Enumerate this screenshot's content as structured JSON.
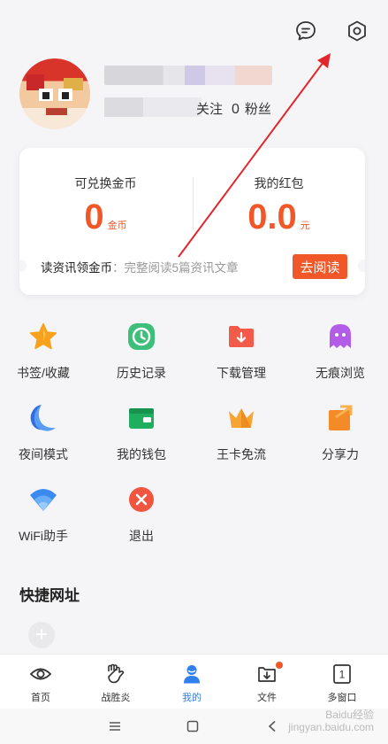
{
  "profile": {
    "following_count": "0",
    "following_label_partial": "关注",
    "fans_count": "0",
    "fans_label": "粉丝"
  },
  "wallet": {
    "coins_label": "可兑换金币",
    "coins_value": "0",
    "coins_unit": "金币",
    "redpacket_label": "我的红包",
    "redpacket_value": "0.0",
    "redpacket_unit": "元",
    "read_title": "读资讯领金币",
    "read_desc": "：完整阅读5篇资讯文章",
    "read_button": "去阅读"
  },
  "features": [
    {
      "label": "书签/收藏",
      "icon": "star-icon"
    },
    {
      "label": "历史记录",
      "icon": "clock-icon"
    },
    {
      "label": "下载管理",
      "icon": "download-folder-icon"
    },
    {
      "label": "无痕浏览",
      "icon": "ghost-icon"
    },
    {
      "label": "夜间模式",
      "icon": "moon-icon"
    },
    {
      "label": "我的钱包",
      "icon": "wallet-icon"
    },
    {
      "label": "王卡免流",
      "icon": "crown-icon"
    },
    {
      "label": "分享力",
      "icon": "share-box-icon"
    },
    {
      "label": "WiFi助手",
      "icon": "wifi-icon"
    },
    {
      "label": "退出",
      "icon": "exit-icon"
    }
  ],
  "quick_sites": {
    "title": "快捷网址",
    "add_symbol": "+"
  },
  "nav": [
    {
      "label": "首页",
      "icon": "eye-icon"
    },
    {
      "label": "战胜炎",
      "icon": "fist-icon"
    },
    {
      "label": "我的",
      "icon": "person-icon"
    },
    {
      "label": "文件",
      "icon": "file-download-icon"
    },
    {
      "label": "多窗口",
      "icon": "window-count-icon"
    }
  ],
  "window_count": "1",
  "watermark": {
    "line1": "Baidu经验",
    "line2": "jingyan.baidu.com"
  },
  "colors": {
    "accent_orange": "#f0582a",
    "active_blue": "#2f80ed",
    "annotation_red": "#e2262b"
  }
}
